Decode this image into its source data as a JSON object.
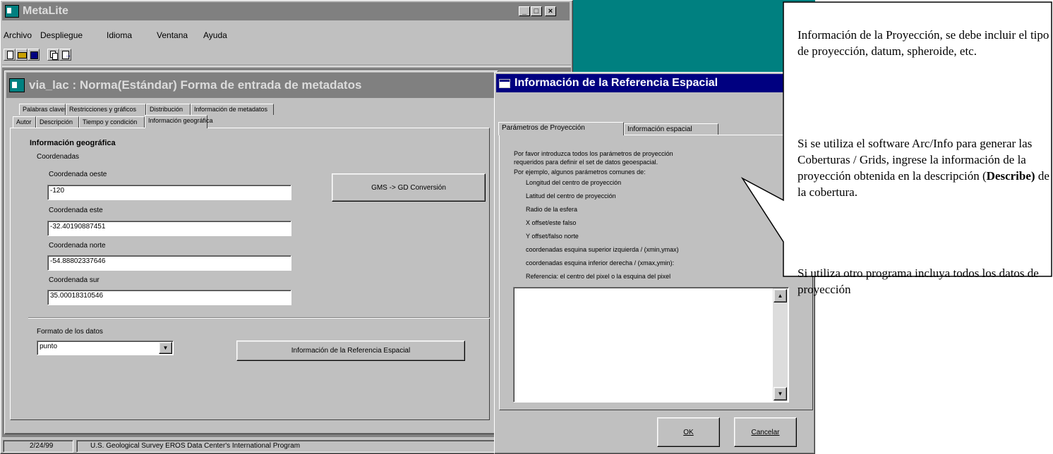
{
  "main_window": {
    "title": "MetaLite",
    "menu": [
      "Archivo",
      "Despliegue",
      "Idioma",
      "Ventana",
      "Ayuda"
    ],
    "controls": [
      "_",
      "□",
      "×"
    ]
  },
  "form_window": {
    "title": "via_lac : Norma(Estándar) Forma de entrada de metadatos",
    "tabs_row1": [
      "Palabras claves",
      "Restricciones y gráficos",
      "Distribución",
      "Información de metadatos"
    ],
    "tabs_row2": [
      "Autor",
      "Descripción",
      "Tiempo y condición",
      "Información geográfica"
    ],
    "section_title": "Información geográfica",
    "group_label": "Coordenadas",
    "fields": [
      {
        "label": "Coordenada oeste",
        "value": "-120"
      },
      {
        "label": "Coordenada este",
        "value": "-32.40190887451"
      },
      {
        "label": "Coordenada norte",
        "value": "-54.88802337646"
      },
      {
        "label": "Coordenada sur",
        "value": "35.00018310546"
      }
    ],
    "conversion_button": "GMS -> GD Conversión",
    "format_label": "Formato de los datos",
    "format_value": "punto",
    "spatial_ref_button": "Información de la Referencia Espacial"
  },
  "status_bar": {
    "date": "2/24/99",
    "text": "U.S. Geological Survey EROS Data Center's International Program"
  },
  "dialog": {
    "title": "Información de la Referencia Espacial",
    "tabs": [
      "Parámetros de Proyección",
      "Información espacial"
    ],
    "intro": [
      "Por favor introduzca todos los parámetros de proyección",
      "requeridos para definir el set de datos geoespacial."
    ],
    "example_title": "Por ejemplo, algunos parámetros comunes de:",
    "examples": [
      "Longitud del centro de proyección",
      "Latitud del centro de proyección",
      "Radio de la esfera",
      "X offset/este falso",
      "Y offset/falso norte",
      "coordenadas esquina superior izquierda / (xmin,ymax)",
      "coordenadas esquina inferior derecha / (xmax,ymin):",
      "Referencia: el centro del pixel o la esquina del pixel"
    ],
    "ok_label": "OK",
    "cancel_label": "Cancelar"
  },
  "callout": {
    "para1": "Información de la Proyección, se debe incluir el tipo de proyección, datum, spheroide, etc.",
    "para2_before": "Si se utiliza el software Arc/Info para generar las Coberturas / Grids, ingrese la información de la proyección obtenida en la descripción (",
    "para2_bold": "Describe)",
    "para2_after": " de la cobertura.",
    "para3": "Si utiliza otro programa incluya todos los datos de proyección"
  },
  "colors": {
    "titlebar_active": "#000080",
    "titlebar_inactive": "#808080",
    "desktop": "#008080",
    "face": "#c0c0c0"
  }
}
